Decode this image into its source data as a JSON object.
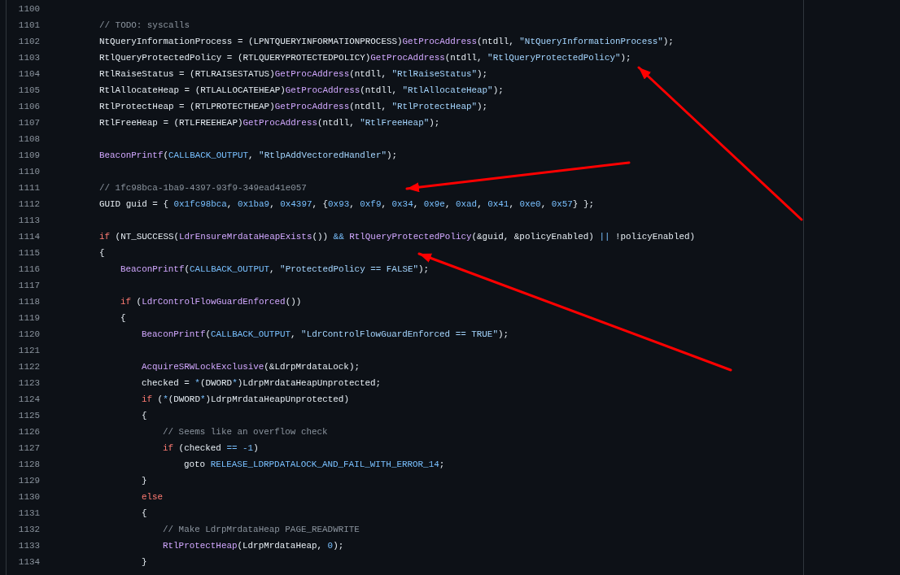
{
  "code_view": {
    "lines": [
      {
        "number": "1100"
      },
      {
        "number": "1101",
        "tokens": [
          {
            "kind": "comment",
            "text": "// TODO: syscalls"
          }
        ]
      },
      {
        "number": "1102",
        "tokens": [
          {
            "kind": "plain",
            "text": "NtQueryInformationProcess = (LPNTQUERYINFORMATIONPROCESS)"
          },
          {
            "kind": "function",
            "text": "GetProcAddress"
          },
          {
            "kind": "plain",
            "text": "(ntdll, "
          },
          {
            "kind": "string",
            "text": "\"NtQueryInformationProcess\""
          },
          {
            "kind": "plain",
            "text": ");"
          }
        ]
      },
      {
        "number": "1103",
        "tokens": [
          {
            "kind": "plain",
            "text": "RtlQueryProtectedPolicy = (RTLQUERYPROTECTEDPOLICY)"
          },
          {
            "kind": "function",
            "text": "GetProcAddress"
          },
          {
            "kind": "plain",
            "text": "(ntdll, "
          },
          {
            "kind": "string",
            "text": "\"RtlQueryProtectedPolicy\""
          },
          {
            "kind": "plain",
            "text": ");"
          }
        ]
      },
      {
        "number": "1104",
        "tokens": [
          {
            "kind": "plain",
            "text": "RtlRaiseStatus = (RTLRAISESTATUS)"
          },
          {
            "kind": "function",
            "text": "GetProcAddress"
          },
          {
            "kind": "plain",
            "text": "(ntdll, "
          },
          {
            "kind": "string",
            "text": "\"RtlRaiseStatus\""
          },
          {
            "kind": "plain",
            "text": ");"
          }
        ]
      },
      {
        "number": "1105",
        "tokens": [
          {
            "kind": "plain",
            "text": "RtlAllocateHeap = (RTLALLOCATEHEAP)"
          },
          {
            "kind": "function",
            "text": "GetProcAddress"
          },
          {
            "kind": "plain",
            "text": "(ntdll, "
          },
          {
            "kind": "string",
            "text": "\"RtlAllocateHeap\""
          },
          {
            "kind": "plain",
            "text": ");"
          }
        ]
      },
      {
        "number": "1106",
        "tokens": [
          {
            "kind": "plain",
            "text": "RtlProtectHeap = (RTLPROTECTHEAP)"
          },
          {
            "kind": "function",
            "text": "GetProcAddress"
          },
          {
            "kind": "plain",
            "text": "(ntdll, "
          },
          {
            "kind": "string",
            "text": "\"RtlProtectHeap\""
          },
          {
            "kind": "plain",
            "text": ");"
          }
        ]
      },
      {
        "number": "1107",
        "tokens": [
          {
            "kind": "plain",
            "text": "RtlFreeHeap = (RTLFREEHEAP)"
          },
          {
            "kind": "function",
            "text": "GetProcAddress"
          },
          {
            "kind": "plain",
            "text": "(ntdll, "
          },
          {
            "kind": "string",
            "text": "\"RtlFreeHeap\""
          },
          {
            "kind": "plain",
            "text": ");"
          }
        ]
      },
      {
        "number": "1108"
      },
      {
        "number": "1109",
        "tokens": [
          {
            "kind": "function",
            "text": "BeaconPrintf"
          },
          {
            "kind": "plain",
            "text": "("
          },
          {
            "kind": "constant",
            "text": "CALLBACK_OUTPUT"
          },
          {
            "kind": "plain",
            "text": ", "
          },
          {
            "kind": "string",
            "text": "\"RtlpAddVectoredHandler\""
          },
          {
            "kind": "plain",
            "text": ");"
          }
        ]
      },
      {
        "number": "1110"
      },
      {
        "number": "1111",
        "tokens": [
          {
            "kind": "comment",
            "text": "// 1fc98bca-1ba9-4397-93f9-349ead41e057"
          }
        ]
      },
      {
        "number": "1112",
        "tokens": [
          {
            "kind": "plain",
            "text": "GUID guid = { "
          },
          {
            "kind": "constant",
            "text": "0x1fc98bca"
          },
          {
            "kind": "plain",
            "text": ", "
          },
          {
            "kind": "constant",
            "text": "0x1ba9"
          },
          {
            "kind": "plain",
            "text": ", "
          },
          {
            "kind": "constant",
            "text": "0x4397"
          },
          {
            "kind": "plain",
            "text": ", {"
          },
          {
            "kind": "constant",
            "text": "0x93"
          },
          {
            "kind": "plain",
            "text": ", "
          },
          {
            "kind": "constant",
            "text": "0xf9"
          },
          {
            "kind": "plain",
            "text": ", "
          },
          {
            "kind": "constant",
            "text": "0x34"
          },
          {
            "kind": "plain",
            "text": ", "
          },
          {
            "kind": "constant",
            "text": "0x9e"
          },
          {
            "kind": "plain",
            "text": ", "
          },
          {
            "kind": "constant",
            "text": "0xad"
          },
          {
            "kind": "plain",
            "text": ", "
          },
          {
            "kind": "constant",
            "text": "0x41"
          },
          {
            "kind": "plain",
            "text": ", "
          },
          {
            "kind": "constant",
            "text": "0xe0"
          },
          {
            "kind": "plain",
            "text": ", "
          },
          {
            "kind": "constant",
            "text": "0x57"
          },
          {
            "kind": "plain",
            "text": "} };"
          }
        ]
      },
      {
        "number": "1113"
      },
      {
        "number": "1114",
        "tokens": [
          {
            "kind": "keyword",
            "text": "if"
          },
          {
            "kind": "plain",
            "text": " (NT_SUCCESS("
          },
          {
            "kind": "function",
            "text": "LdrEnsureMrdataHeapExists"
          },
          {
            "kind": "plain",
            "text": "()) "
          },
          {
            "kind": "constant",
            "text": "&& "
          },
          {
            "kind": "function",
            "text": "RtlQueryProtectedPolicy"
          },
          {
            "kind": "plain",
            "text": "(&guid, &policyEnabled) "
          },
          {
            "kind": "constant",
            "text": "||"
          },
          {
            "kind": "plain",
            "text": " !policyEnabled)"
          }
        ]
      },
      {
        "number": "1115",
        "tokens": [
          {
            "kind": "plain",
            "text": "{"
          }
        ],
        "children": [
          {
            "number": "1116",
            "tokens": [
              {
                "kind": "function",
                "text": "BeaconPrintf"
              },
              {
                "kind": "plain",
                "text": "("
              },
              {
                "kind": "constant",
                "text": "CALLBACK_OUTPUT"
              },
              {
                "kind": "plain",
                "text": ", "
              },
              {
                "kind": "string",
                "text": "\"ProtectedPolicy == FALSE\""
              },
              {
                "kind": "plain",
                "text": ");"
              }
            ]
          },
          {
            "number": "1117"
          },
          {
            "number": "1118",
            "tokens": [
              {
                "kind": "keyword",
                "text": "if"
              },
              {
                "kind": "plain",
                "text": " ("
              },
              {
                "kind": "function",
                "text": "LdrControlFlowGuardEnforced"
              },
              {
                "kind": "plain",
                "text": "())"
              }
            ]
          },
          {
            "number": "1119",
            "tokens": [
              {
                "kind": "plain",
                "text": "{"
              }
            ],
            "children": [
              {
                "number": "1120",
                "tokens": [
                  {
                    "kind": "function",
                    "text": "BeaconPrintf"
                  },
                  {
                    "kind": "plain",
                    "text": "("
                  },
                  {
                    "kind": "constant",
                    "text": "CALLBACK_OUTPUT"
                  },
                  {
                    "kind": "plain",
                    "text": ", "
                  },
                  {
                    "kind": "string",
                    "text": "\"LdrControlFlowGuardEnforced == TRUE\""
                  },
                  {
                    "kind": "plain",
                    "text": ");"
                  }
                ]
              },
              {
                "number": "1121"
              },
              {
                "number": "1122",
                "tokens": [
                  {
                    "kind": "function",
                    "text": "AcquireSRWLockExclusive"
                  },
                  {
                    "kind": "plain",
                    "text": "(&LdrpMrdataLock);"
                  }
                ]
              },
              {
                "number": "1123",
                "tokens": [
                  {
                    "kind": "plain",
                    "text": "checked = "
                  },
                  {
                    "kind": "constant",
                    "text": "*"
                  },
                  {
                    "kind": "plain",
                    "text": "(DWORD"
                  },
                  {
                    "kind": "constant",
                    "text": "*"
                  },
                  {
                    "kind": "plain",
                    "text": ")LdrpMrdataHeapUnprotected;"
                  }
                ]
              },
              {
                "number": "1124",
                "tokens": [
                  {
                    "kind": "keyword",
                    "text": "if"
                  },
                  {
                    "kind": "plain",
                    "text": " ("
                  },
                  {
                    "kind": "constant",
                    "text": "*"
                  },
                  {
                    "kind": "plain",
                    "text": "(DWORD"
                  },
                  {
                    "kind": "constant",
                    "text": "*"
                  },
                  {
                    "kind": "plain",
                    "text": ")LdrpMrdataHeapUnprotected)"
                  }
                ]
              },
              {
                "number": "1125",
                "tokens": [
                  {
                    "kind": "plain",
                    "text": "{"
                  }
                ],
                "children": [
                  {
                    "number": "1126",
                    "tokens": [
                      {
                        "kind": "comment",
                        "text": "// Seems like an overflow check"
                      }
                    ]
                  },
                  {
                    "number": "1127",
                    "tokens": [
                      {
                        "kind": "keyword",
                        "text": "if"
                      },
                      {
                        "kind": "plain",
                        "text": " (checked "
                      },
                      {
                        "kind": "constant",
                        "text": "== "
                      },
                      {
                        "kind": "constant",
                        "text": "-1"
                      },
                      {
                        "kind": "plain",
                        "text": ")"
                      }
                    ],
                    "children": [
                      {
                        "number": "1128",
                        "tokens": [
                          {
                            "kind": "plain",
                            "text": "goto "
                          },
                          {
                            "kind": "constant",
                            "text": "RELEASE_LDRPDATALOCK_AND_FAIL_WITH_ERROR_14"
                          },
                          {
                            "kind": "plain",
                            "text": ";"
                          }
                        ]
                      }
                    ]
                  }
                ]
              },
              {
                "number": "1129",
                "tokens": [
                  {
                    "kind": "plain",
                    "text": "}"
                  }
                ]
              },
              {
                "number": "1130",
                "tokens": [
                  {
                    "kind": "keyword",
                    "text": "else"
                  }
                ]
              },
              {
                "number": "1131",
                "tokens": [
                  {
                    "kind": "plain",
                    "text": "{"
                  }
                ],
                "children": [
                  {
                    "number": "1132",
                    "tokens": [
                      {
                        "kind": "comment",
                        "text": "// Make LdrpMrdataHeap PAGE_READWRITE"
                      }
                    ]
                  },
                  {
                    "number": "1133",
                    "tokens": [
                      {
                        "kind": "function",
                        "text": "RtlProtectHeap"
                      },
                      {
                        "kind": "plain",
                        "text": "(LdrpMrdataHeap, "
                      },
                      {
                        "kind": "constant",
                        "text": "0"
                      },
                      {
                        "kind": "plain",
                        "text": ");"
                      }
                    ]
                  }
                ]
              },
              {
                "number": "1134",
                "tokens": [
                  {
                    "kind": "plain",
                    "text": "}"
                  }
                ]
              }
            ]
          }
        ]
      }
    ]
  }
}
